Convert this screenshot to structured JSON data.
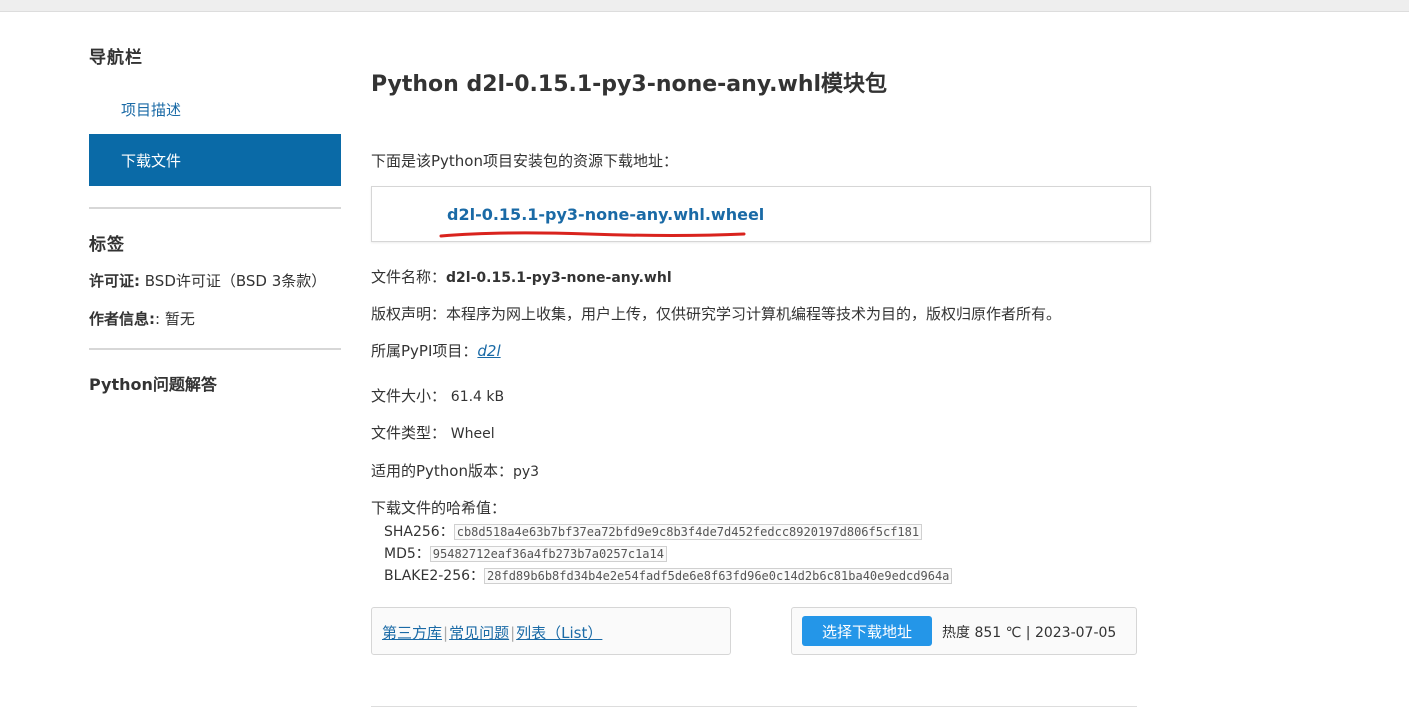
{
  "sidebar": {
    "nav_heading": "导航栏",
    "nav_items": [
      {
        "label": "项目描述",
        "glyph": "",
        "glyph_after": ""
      },
      {
        "label": "下载文件",
        "glyph": "",
        "glyph_after": ""
      }
    ],
    "tags_heading": "标签",
    "license_label": "许可证:",
    "license_value": " BSD许可证（BSD 3条款）",
    "author_label": "作者信息:",
    "author_value": ": 暂无",
    "qa_heading": "Python问题解答"
  },
  "main": {
    "title": "Python d2l-0.15.1-py3-none-any.whl模块包",
    "intro": "下面是该Python项目安装包的资源下载地址：",
    "download_link": "d2l-0.15.1-py3-none-any.whl.wheel",
    "filename_label": "文件名称：",
    "filename_value": "d2l-0.15.1-py3-none-any.whl",
    "copyright": "版权声明：本程序为网上收集，用户上传，仅供研究学习计算机编程等技术为目的，版权归原作者所有。",
    "pypi_label": "所属PyPI项目：",
    "pypi_link": "d2l",
    "pypi_glyph": "",
    "size_label": "文件大小：",
    "size_value": "61.4 kB",
    "type_label": "文件类型：",
    "type_value": "Wheel",
    "pyver_label": "适用的Python版本：",
    "pyver_value": "py3",
    "hash_heading": "下载文件的哈希值：",
    "hashes": [
      {
        "label": "SHA256：",
        "value": "cb8d518a4e63b7bf37ea72bfd9e9c8b3f4de7d452fedcc8920197d806f5cf181"
      },
      {
        "label": "MD5：",
        "value": "95482712eaf36a4fb273b7a0257c1a14"
      },
      {
        "label": "BLAKE2-256：",
        "value": "28fd89b6b8fd34b4e2e54fadf5de6e8f63fd96e0c14d2b6c81ba40e9edcd964a"
      }
    ]
  },
  "footer": {
    "links": [
      "第三方库",
      "常见问题",
      "列表（List）"
    ],
    "link_glyph": "",
    "separator": "|",
    "select_button": "选择下载地址",
    "heat": "热度 851 ℃ | 2023-07-05"
  },
  "colors": {
    "accent": "#0a6aa7",
    "link": "#1a6aa6",
    "button": "#2496e8",
    "underline": "#d9231d"
  }
}
